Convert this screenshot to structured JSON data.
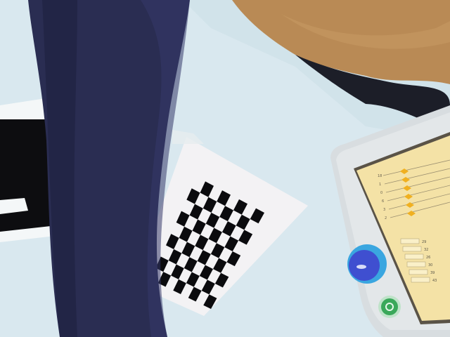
{
  "scene": {
    "description_tags": [
      "table",
      "checkerboard",
      "fiducial-marker",
      "leg",
      "touch-device"
    ],
    "colors": {
      "table": "#d6e6ee",
      "table_shadow": "#b9d3df",
      "cloth": "#b98a55",
      "leg": "#2a2d52",
      "device_body": "#d8dde0",
      "screen": "#f4e2a6",
      "button_blue": "#3f4fd0",
      "button_ring": "#3aa6e0",
      "button_green": "#3aa85a"
    }
  },
  "checkerboard": {
    "rows": 9,
    "cols": 8
  },
  "device_screen": {
    "rows": [
      {
        "label": "18",
        "level": 0.55
      },
      {
        "label": "1",
        "level": 0.6
      },
      {
        "label": "0",
        "level": 0.5
      },
      {
        "label": "6",
        "level": 0.62
      },
      {
        "label": "3",
        "level": 0.58
      },
      {
        "label": "2",
        "level": 0.57
      }
    ],
    "readings": [
      "29",
      "32",
      "26",
      "30",
      "39",
      "43"
    ]
  }
}
